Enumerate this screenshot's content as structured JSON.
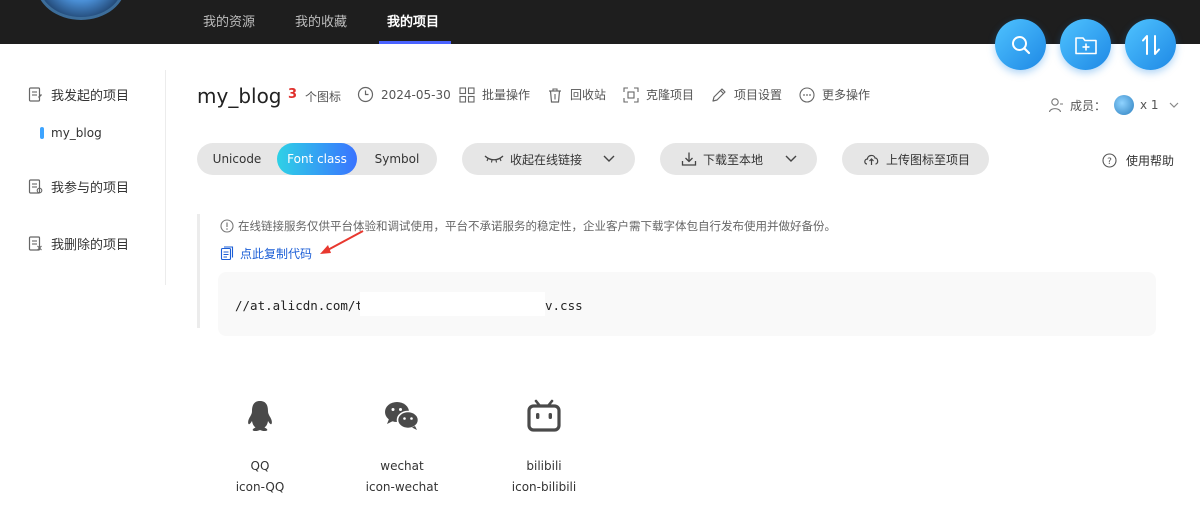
{
  "topnav": {
    "tabs": [
      "我的资源",
      "我的收藏",
      "我的项目"
    ],
    "active_tab": "我的项目"
  },
  "fab": {
    "icons": [
      "search-icon",
      "add-folder-icon",
      "sort-icon"
    ],
    "color": "#1e88e5"
  },
  "sidebar": {
    "my_projects": "我发起的项目",
    "current_project": "my_blog",
    "joined_projects": "我参与的项目",
    "deleted_projects": "我删除的项目"
  },
  "project": {
    "name": "my_blog",
    "icon_count": "3",
    "icon_count_label": "个图标",
    "date": "2024-05-30",
    "batch": "批量操作",
    "recycle": "回收站",
    "clone": "克隆项目",
    "settings": "项目设置",
    "more": "更多操作",
    "members_label": "成员：",
    "members_count": "x 1"
  },
  "mode_tabs": [
    "Unicode",
    "Font class",
    "Symbol"
  ],
  "active_mode": "Font class",
  "actions": {
    "online_link": "收起在线链接",
    "download": "下载至本地",
    "upload": "上传图标至项目",
    "help": "使用帮助"
  },
  "notice": {
    "text": "在线链接服务仅供平台体验和调试使用，平台不承诺服务的稳定性，企业客户需下载字体包自行发布使用并做好备份。",
    "copy_code": "点此复制代码",
    "code_head": "//at.alicdn.com/t/",
    "code_tail": "v.css"
  },
  "icons": [
    {
      "name": "QQ",
      "class": "icon-QQ",
      "glyph": "qq-icon"
    },
    {
      "name": "wechat",
      "class": "icon-wechat",
      "glyph": "wechat-icon"
    },
    {
      "name": "bilibili",
      "class": "icon-bilibili",
      "glyph": "bilibili-icon"
    }
  ],
  "colors": {
    "topbar": "#1e1e1e",
    "accent_blue": "#1b5ed6",
    "count_red": "#e0312d",
    "arrow_red": "#e8382f"
  }
}
